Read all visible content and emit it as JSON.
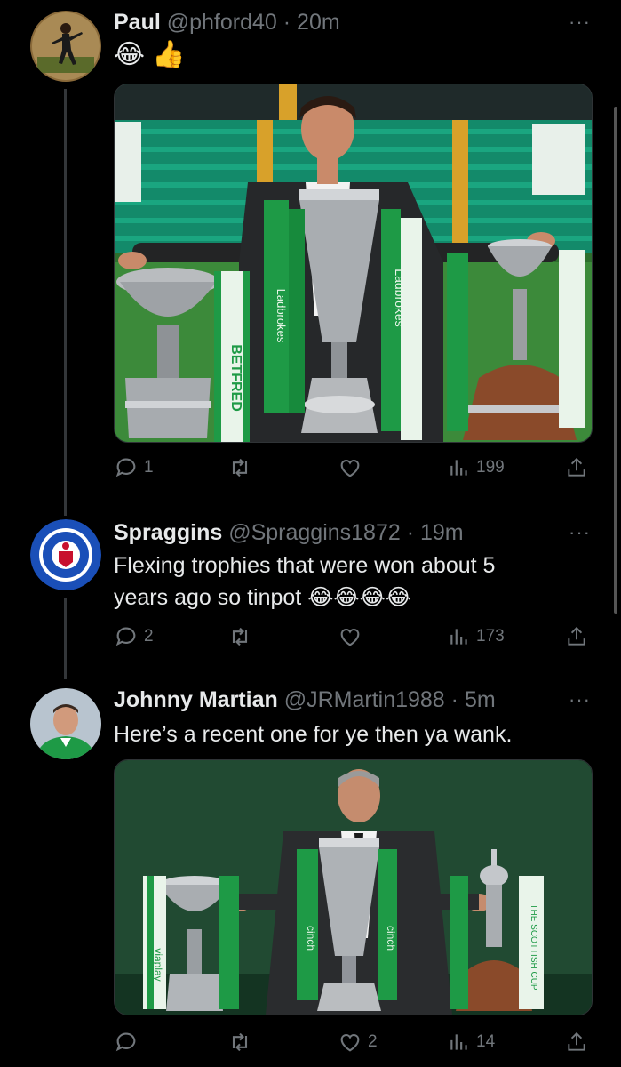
{
  "tweets": [
    {
      "name": "Paul",
      "handle": "@phford40",
      "time": "20m",
      "text": "😂 👍",
      "replies": "1",
      "retweets": "",
      "likes": "",
      "views": "199",
      "media": {
        "banner_texts": [
          "Ladbrokes",
          "BETFRED",
          "BETFRED",
          "Ladbrokes"
        ]
      }
    },
    {
      "name": "Spraggins",
      "handle": "@Spraggins1872",
      "time": "19m",
      "text_line1": "Flexing trophies that were won about 5",
      "text_line2": "years ago so tinpot 😂😂😂😂",
      "replies": "2",
      "retweets": "",
      "likes": "",
      "views": "173",
      "avatar_text": "RANGERS FOOTBALL CLUB"
    },
    {
      "name": "Johnny Martian",
      "handle": "@JRMartin1988",
      "time": "5m",
      "text": "Here’s a recent one for ye then ya wank.",
      "replies": "",
      "retweets": "",
      "likes": "2",
      "views": "14",
      "media": {
        "banner_texts": [
          "viaplay",
          "cinch",
          "cinch",
          "THE SCOTTISH CUP"
        ]
      }
    }
  ],
  "separator": " · ",
  "more_label": "···",
  "colors": {
    "background": "#000000",
    "text": "#e7e9ea",
    "muted": "#71767b",
    "celtic_green": "#1b8a3c"
  },
  "icons": [
    "reply-icon",
    "retweet-icon",
    "like-icon",
    "views-icon",
    "share-icon",
    "more-icon"
  ]
}
